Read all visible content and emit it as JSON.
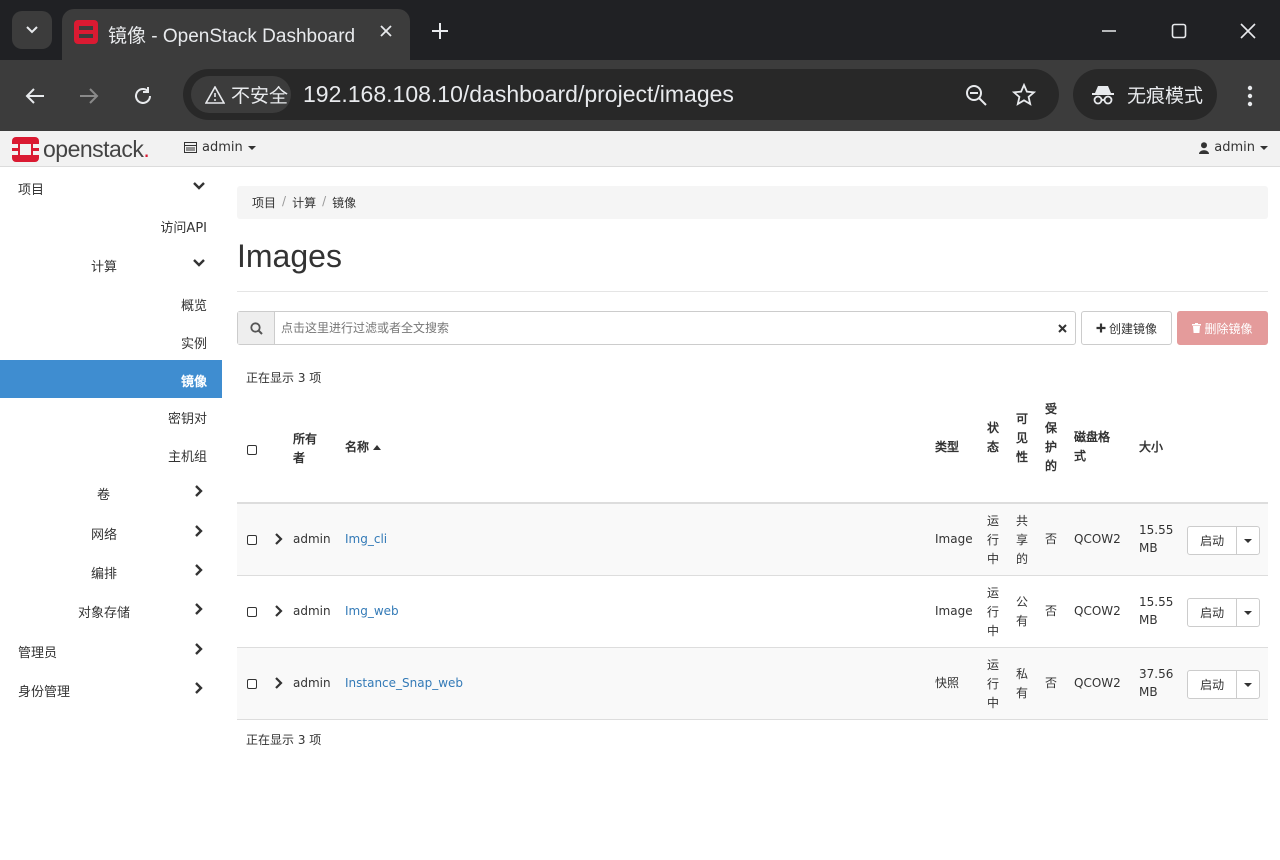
{
  "browser": {
    "tab_title": "镜像 - OpenStack Dashboard",
    "insecure_label": "不安全",
    "url": "192.168.108.10/dashboard/project/images",
    "incognito_label": "无痕模式"
  },
  "header": {
    "logo_text": "openstack",
    "logo_dot": ".",
    "project": "admin",
    "user": "admin"
  },
  "sidebar": {
    "items": [
      {
        "label": "项目"
      },
      {
        "label": "访问API"
      },
      {
        "label": "计算"
      },
      {
        "label": "概览"
      },
      {
        "label": "实例"
      },
      {
        "label": "镜像"
      },
      {
        "label": "密钥对"
      },
      {
        "label": "主机组"
      },
      {
        "label": "卷"
      },
      {
        "label": "网络"
      },
      {
        "label": "编排"
      },
      {
        "label": "对象存储"
      },
      {
        "label": "管理员"
      },
      {
        "label": "身份管理"
      }
    ]
  },
  "main": {
    "breadcrumb": [
      "项目",
      "计算",
      "镜像"
    ],
    "breadcrumb_sep": "/",
    "title": "Images",
    "search_placeholder": "点击这里进行过滤或者全文搜索",
    "create_label": "创建镜像",
    "delete_label": "删除镜像",
    "count_text": "正在显示 3 项",
    "columns": {
      "owner": "所有者",
      "name": "名称",
      "type": "类型",
      "status": "状态",
      "visibility": "可见性",
      "protected": "受保护的",
      "disk_format": "磁盘格式",
      "size": "大小"
    },
    "rows": [
      {
        "owner": "admin",
        "name": "Img_cli",
        "type": "Image",
        "status": "运行中",
        "visibility": "共享的",
        "protected": "否",
        "disk_format": "QCOW2",
        "size_1": "15.55",
        "size_2": "MB",
        "action": "启动"
      },
      {
        "owner": "admin",
        "name": "Img_web",
        "type": "Image",
        "status": "运行中",
        "visibility": "公有",
        "protected": "否",
        "disk_format": "QCOW2",
        "size_1": "15.55",
        "size_2": "MB",
        "action": "启动"
      },
      {
        "owner": "admin",
        "name": "Instance_Snap_web",
        "type": "快照",
        "status": "运行中",
        "visibility": "私有",
        "protected": "否",
        "disk_format": "QCOW2",
        "size_1": "37.56",
        "size_2": "MB",
        "action": "启动"
      }
    ]
  },
  "colors": {
    "active_nav": "#3f8dd0",
    "link": "#337ab7",
    "delete_btn": "#e49b9b",
    "logo_red": "#da1a32"
  }
}
